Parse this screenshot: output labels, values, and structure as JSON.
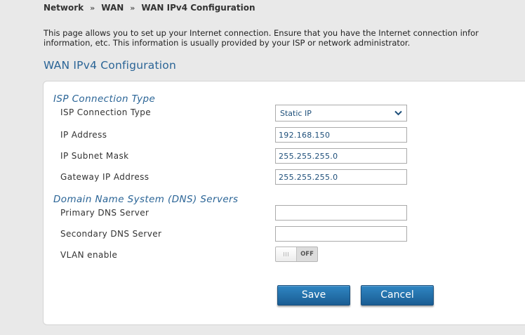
{
  "breadcrumb": {
    "items": [
      "Network",
      "WAN",
      "WAN IPv4 Configuration"
    ],
    "separator": "»"
  },
  "description": {
    "line1": "This page allows you to set up your Internet connection. Ensure that you have the Internet connection infor",
    "line2": "information, etc. This information is usually provided by your ISP or network administrator."
  },
  "page_title": "WAN IPv4 Configuration",
  "isp_section": {
    "title": "ISP Connection Type",
    "connection_type_label": "ISP Connection Type",
    "connection_type_value": "Static IP",
    "ip_address_label": "IP Address",
    "ip_address_value": "192.168.150",
    "subnet_mask_label": "IP Subnet Mask",
    "subnet_mask_value": "255.255.255.0",
    "gateway_label": "Gateway IP Address",
    "gateway_value": "255.255.255.0"
  },
  "dns_section": {
    "title": "Domain Name System (DNS) Servers",
    "primary_label": "Primary DNS Server",
    "primary_value": "",
    "secondary_label": "Secondary DNS Server",
    "secondary_value": ""
  },
  "vlan": {
    "label": "VLAN enable",
    "state_text": "OFF"
  },
  "buttons": {
    "save": "Save",
    "cancel": "Cancel"
  },
  "colors": {
    "accent": "#2a6496",
    "button": "#1f6aa5",
    "background": "#e9e9e9"
  },
  "icons": {
    "select_arrow": "chevron-down-icon"
  }
}
